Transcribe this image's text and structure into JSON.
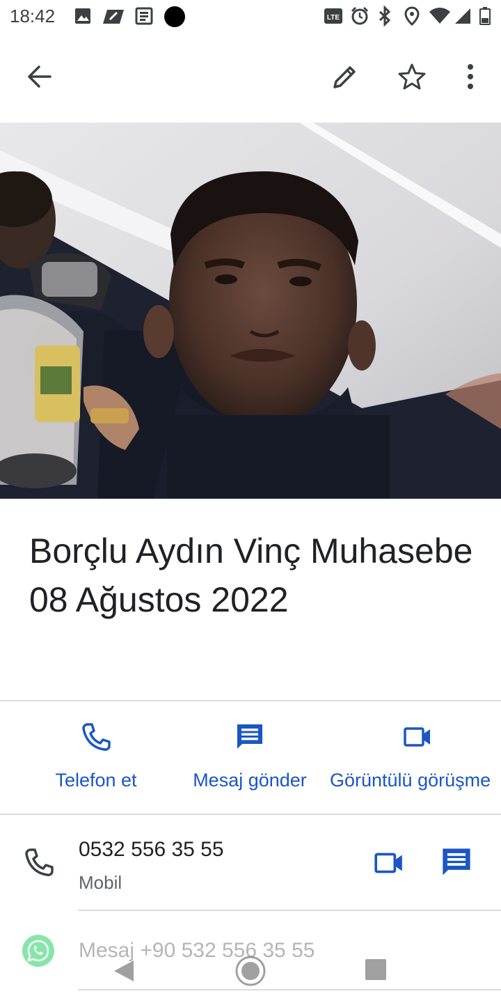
{
  "status_bar": {
    "time": "18:42",
    "network": "LTE",
    "left_icons": [
      "image-icon",
      "app-icon",
      "news-icon",
      "dot-icon"
    ],
    "right_icons": [
      "lte-icon",
      "alarm-icon",
      "bluetooth-icon",
      "location-icon",
      "wifi-icon",
      "signal-icon",
      "battery-icon"
    ]
  },
  "app_bar": {
    "icons": [
      "back-arrow-icon",
      "edit-pencil-icon",
      "star-outline-icon",
      "more-vert-icon"
    ]
  },
  "contact": {
    "name": "Borçlu Aydın Vinç Muhasebe 08 Ağustos 2022"
  },
  "actions": [
    {
      "label": "Telefon et",
      "icon": "phone-icon"
    },
    {
      "label": "Mesaj gönder",
      "icon": "message-icon"
    },
    {
      "label": "Görüntülü görüşme",
      "icon": "video-icon"
    }
  ],
  "phone": {
    "number": "0532 556 35 55",
    "type": "Mobil"
  },
  "whatsapp": {
    "label": "Mesaj +90 532 556 35 55",
    "icon": "whatsapp-icon"
  },
  "colors": {
    "accent": "#1a56c4",
    "text_primary": "#202124",
    "text_secondary": "#5f6368",
    "divider": "#dadce0",
    "whatsapp": "#25d366"
  }
}
